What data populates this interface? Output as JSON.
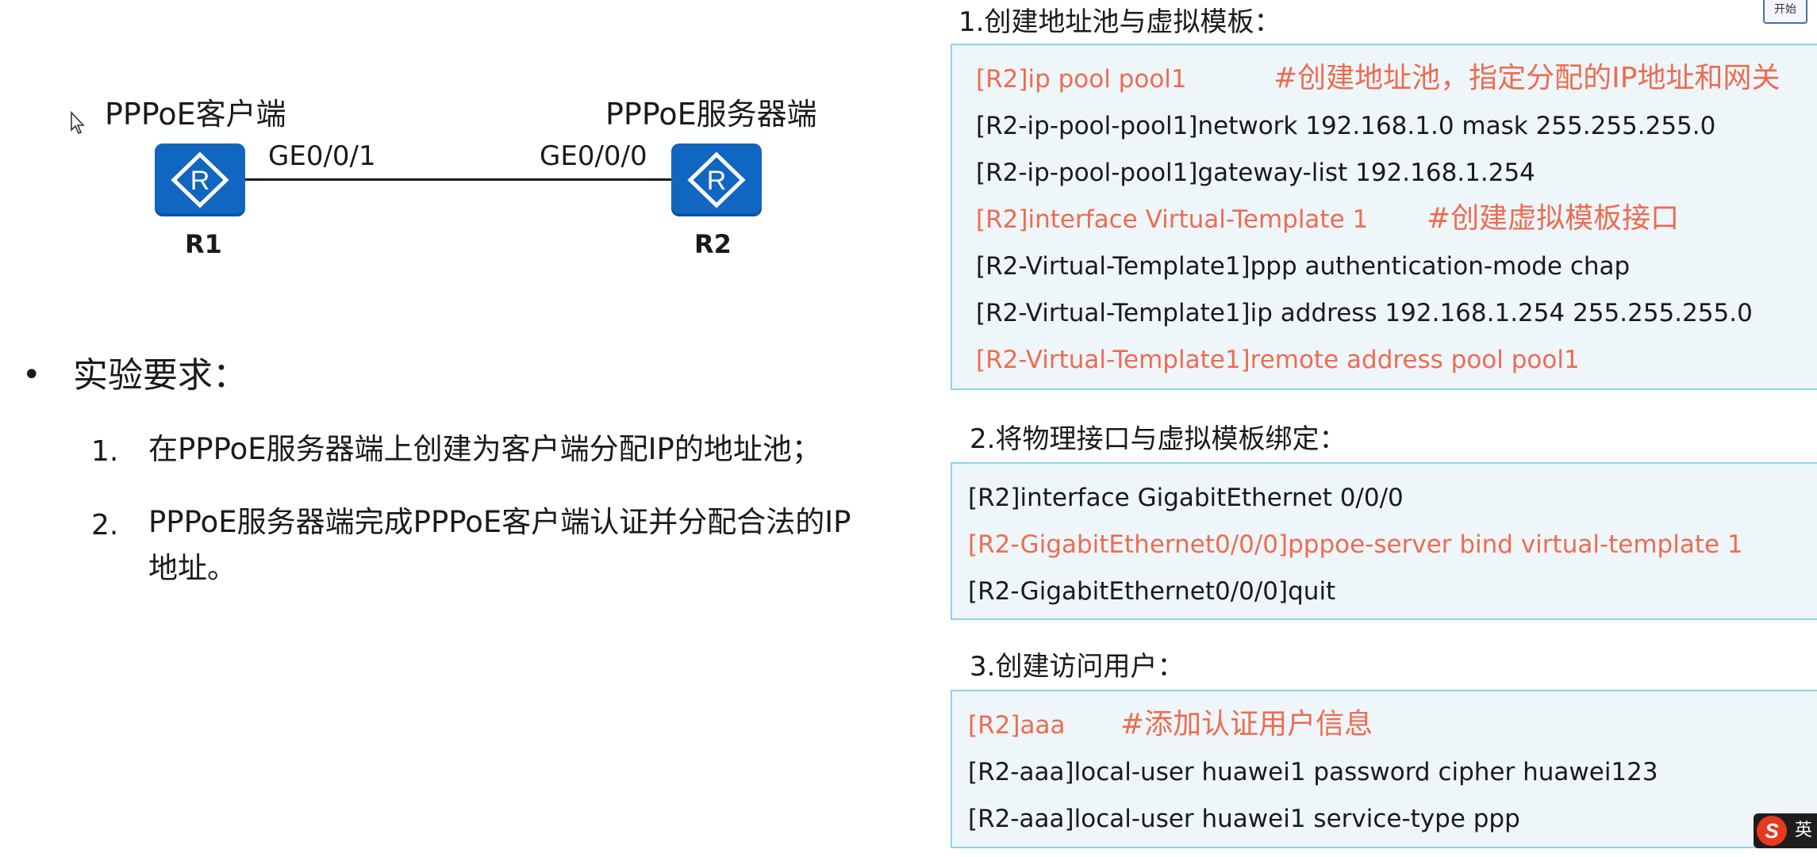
{
  "topology": {
    "r1_role": "PPPoE客户端",
    "r2_role": "PPPoE服务器端",
    "r1_port": "GE0/0/1",
    "r2_port": "GE0/0/0",
    "r1_name": "R1",
    "r2_name": "R2",
    "router_glyph": "R"
  },
  "requirements": {
    "bullet": "•",
    "title": "实验要求：",
    "items": [
      {
        "num": "1.",
        "text": "在PPPoE服务器端上创建为客户端分配IP的地址池；"
      },
      {
        "num": "2.",
        "text_line1": "PPPoE服务器端完成PPPoE客户端认证并分配合法的IP",
        "text_line2": "地址。"
      }
    ]
  },
  "section1": {
    "title": "1.创建地址池与虚拟模板：",
    "lines": [
      "[R2]ip pool pool1",
      "[R2-ip-pool-pool1]network 192.168.1.0 mask 255.255.255.0",
      "[R2-ip-pool-pool1]gateway-list 192.168.1.254",
      "[R2]interface Virtual-Template 1",
      "[R2-Virtual-Template1]ppp authentication-mode chap",
      "[R2-Virtual-Template1]ip address 192.168.1.254 255.255.255.0",
      "[R2-Virtual-Template1]remote address pool pool1"
    ],
    "comment1": "#创建地址池，指定分配的IP地址和网关",
    "comment2": "#创建虚拟模板接口"
  },
  "section2": {
    "title": "2.将物理接口与虚拟模板绑定：",
    "lines": [
      "[R2]interface GigabitEthernet 0/0/0",
      "[R2-GigabitEthernet0/0/0]pppoe-server bind virtual-template 1",
      "[R2-GigabitEthernet0/0/0]quit"
    ]
  },
  "section3": {
    "title": "3.创建访问用户：",
    "lines": [
      "[R2]aaa",
      "[R2-aaa]local-user huawei1 password cipher huawei123",
      "[R2-aaa]local-user huawei1 service-type ppp"
    ],
    "comment1": "#添加认证用户信息"
  },
  "corner": {
    "button_label": "开始",
    "ime_logo": "S",
    "ime_mode": "英"
  },
  "colors": {
    "accent_red": "#ee6b50",
    "router_blue": "#1166c2",
    "panel_border": "#8fd3e6",
    "panel_bg": "#eef6fa"
  },
  "icons": [
    "mouse-cursor-icon",
    "router-icon",
    "sogou-ime-icon"
  ]
}
